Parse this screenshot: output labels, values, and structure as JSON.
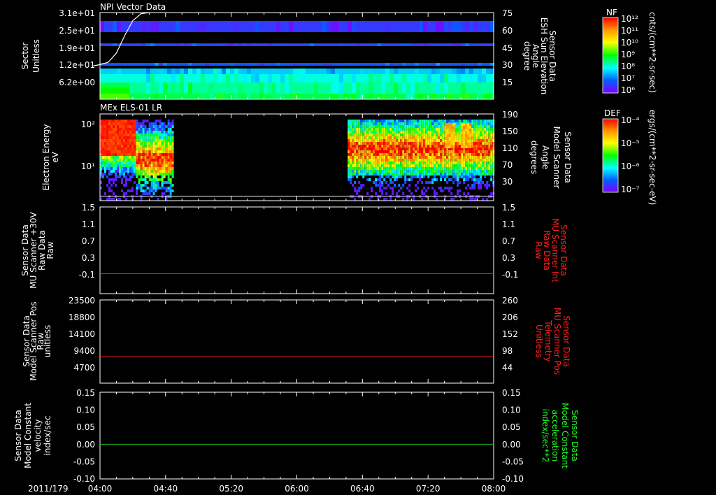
{
  "date_label": "2011/179",
  "time_axis": {
    "start_min": 0,
    "end_min": 240,
    "labels": [
      {
        "t": 0,
        "label": "04:00"
      },
      {
        "t": 40,
        "label": "04:40"
      },
      {
        "t": 80,
        "label": "05:20"
      },
      {
        "t": 120,
        "label": "06:00"
      },
      {
        "t": 160,
        "label": "06:40"
      },
      {
        "t": 200,
        "label": "07:20"
      },
      {
        "t": 240,
        "label": "08:00"
      }
    ]
  },
  "colors": {
    "red_axis": "#ff2020",
    "green_axis": "#20ff20",
    "flat_line_red": "#ff2020",
    "flat_line_green": "#20c020",
    "frame": "#ffffff"
  },
  "colorbars": {
    "npi": {
      "label": "NF",
      "units": "cnts/(cm**2-sr-sec)",
      "ticks": [
        "10¹²",
        "10¹¹",
        "10¹⁰",
        "10⁹",
        "10⁸",
        "10⁷",
        "10⁶"
      ]
    },
    "els": {
      "label": "DEF",
      "units": "ergs/(cm**2-sr-sec-eV)",
      "ticks": [
        "10⁻⁴",
        "10⁻⁵",
        "10⁻⁶",
        "10⁻⁷"
      ]
    }
  },
  "chart_data": [
    {
      "type": "heatmap",
      "title": "NPI Vector Data",
      "ylabel_left": [
        "Sector",
        "Unitless"
      ],
      "ylabel_right": [
        "Sensor Data",
        "ESH Sun Elevation",
        "Angle",
        "degree"
      ],
      "y_left_ticks": [
        "3.1e+01",
        "2.5e+01",
        "1.9e+01",
        "1.2e+01",
        "6.2e+00"
      ],
      "y_right_ticks": [
        "75",
        "60",
        "45",
        "30",
        "15"
      ],
      "y_left_range": [
        0,
        31
      ],
      "y_right_range": [
        0,
        75
      ],
      "bands": [
        {
          "sector_from": 0,
          "sector_to": 2,
          "level": 0.45
        },
        {
          "sector_from": 2,
          "sector_to": 6,
          "level": 0.4
        },
        {
          "sector_from": 6,
          "sector_to": 9,
          "level": 0.35
        },
        {
          "sector_from": 9,
          "sector_to": 11,
          "level": 0.28
        },
        {
          "sector_from": 12,
          "sector_to": 13,
          "level": 0.15
        },
        {
          "sector_from": 19,
          "sector_to": 20,
          "level": 0.12
        },
        {
          "sector_from": 24,
          "sector_to": 28,
          "level": 0.1
        }
      ],
      "overlay_curve": {
        "name": "ESH Sun Elevation Angle",
        "t": [
          0,
          5,
          10,
          15,
          20,
          25,
          30
        ],
        "deg": [
          30,
          32,
          40,
          55,
          68,
          74,
          75
        ]
      }
    },
    {
      "type": "heatmap",
      "title": "MEx ELS-01 LR",
      "ylabel_left": [
        "Electron Energy",
        "eV"
      ],
      "ylabel_right": [
        "Sensor Data",
        "Model Scanner",
        "Angle",
        "degrees"
      ],
      "y_left_ticks": [
        {
          "v": 100,
          "label": "10²"
        },
        {
          "v": 10,
          "label": "10¹"
        }
      ],
      "y_right_ticks": [
        "190",
        "150",
        "110",
        "70",
        "30"
      ],
      "y_left_range_log": [
        1.5,
        180
      ],
      "y_right_range": [
        0,
        190
      ],
      "segments": [
        {
          "t_from": 0,
          "t_to": 22,
          "peak_log_energy": 1.65
        },
        {
          "t_from": 22,
          "t_to": 45,
          "peak_log_energy": 1.2
        },
        {
          "t_from": 151,
          "t_to": 240,
          "peak_log_energy": 1.45
        }
      ],
      "scanner_angle_line": {
        "deg": 10
      }
    },
    {
      "type": "line",
      "ylabel_left": [
        "Sensor Data",
        "MU Scanner +30V",
        "Raw Data",
        "Raw"
      ],
      "ylabel_right": [
        "Sensor Data",
        "MU Scanner Int",
        "Raw Data",
        "Raw"
      ],
      "y_left_ticks": [
        "1.5",
        "1.1",
        "0.7",
        "0.3",
        "-0.1"
      ],
      "y_right_ticks": [
        "1.5",
        "1.1",
        "0.7",
        "0.3",
        "-0.1"
      ],
      "ylim": [
        -0.45,
        1.5
      ],
      "series": [
        {
          "values_constant": 0.0
        }
      ]
    },
    {
      "type": "line",
      "ylabel_left": [
        "Sensor Data",
        "Model Scanner Pos",
        "Raw",
        "unitless"
      ],
      "ylabel_right": [
        "Sensor Data",
        "MU Scanner Pos",
        "Telemetry",
        "Unitless"
      ],
      "y_left_ticks": [
        "23500",
        "18800",
        "14100",
        "9400",
        "4700"
      ],
      "y_right_ticks": [
        "260",
        "206",
        "152",
        "98",
        "44"
      ],
      "ylim": [
        0,
        23500
      ],
      "series": [
        {
          "values_constant": 7450
        }
      ]
    },
    {
      "type": "line",
      "ylabel_left": [
        "Sensor Data",
        "Model Constant",
        "velocity",
        "index/sec"
      ],
      "ylabel_right": [
        "Sensor Data",
        "Model Constant",
        "acceleration",
        "index/sec**2"
      ],
      "y_left_ticks": [
        "0.15",
        "0.10",
        "0.05",
        "0.00",
        "-0.05",
        "-0.10"
      ],
      "y_right_ticks": [
        "0.15",
        "0.10",
        "0.05",
        "0.00",
        "-0.05",
        "-0.10"
      ],
      "ylim": [
        -0.1,
        0.15
      ],
      "series": [
        {
          "values_constant": 0.0
        }
      ]
    }
  ]
}
